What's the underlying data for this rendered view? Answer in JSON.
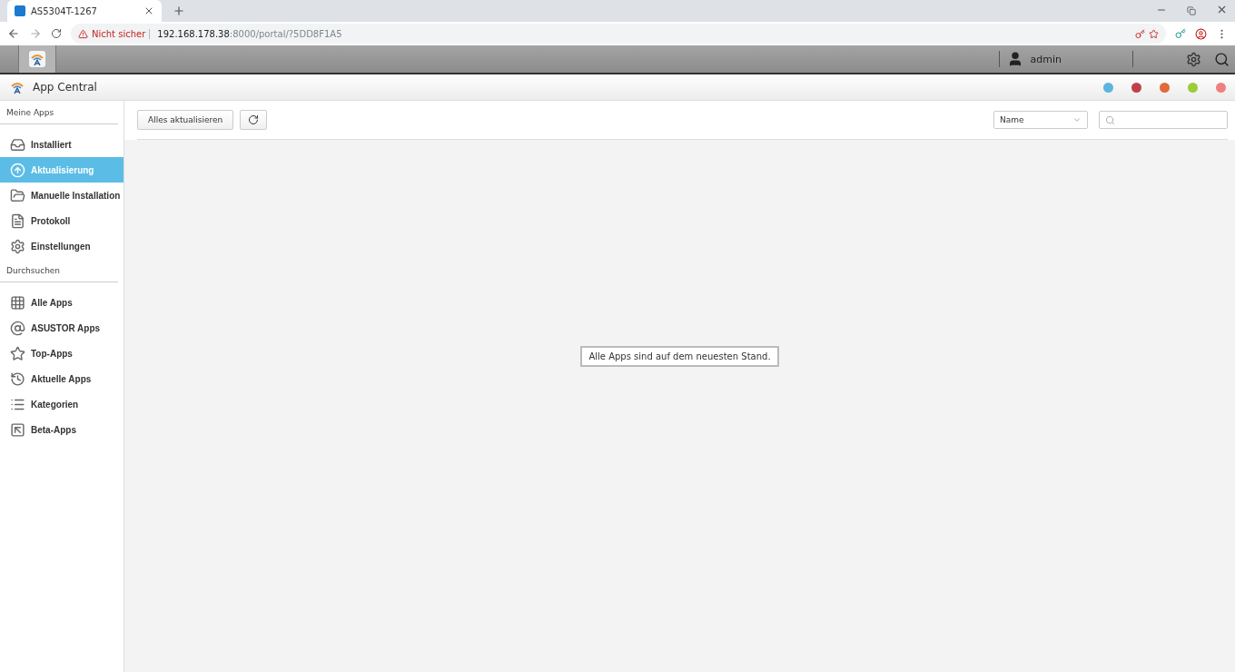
{
  "browser": {
    "tab_title": "AS5304T-1267",
    "security": "Nicht sicher",
    "url_host": "192.168.178.38",
    "url_rest": ":8000/portal/?5DD8F1A5"
  },
  "top_bar": {
    "user": "admin"
  },
  "app": {
    "title": "App Central",
    "window_dots": [
      {
        "color": "#5bb5e0"
      },
      {
        "color": "#c0404a"
      },
      {
        "color": "#e06a3a"
      },
      {
        "color": "#9ccc3a"
      },
      {
        "color": "#f08080"
      }
    ]
  },
  "sidebar": {
    "groups": [
      {
        "title": "Meine Apps",
        "items": [
          {
            "label": "Installiert",
            "selected": false
          },
          {
            "label": "Aktualisierung",
            "selected": true
          },
          {
            "label": "Manuelle Installation",
            "selected": false
          },
          {
            "label": "Protokoll",
            "selected": false
          },
          {
            "label": "Einstellungen",
            "selected": false
          }
        ]
      },
      {
        "title": "Durchsuchen",
        "items": [
          {
            "label": "Alle Apps",
            "selected": false
          },
          {
            "label": "ASUSTOR Apps",
            "selected": false
          },
          {
            "label": "Top-Apps",
            "selected": false
          },
          {
            "label": "Aktuelle Apps",
            "selected": false
          },
          {
            "label": "Kategorien",
            "selected": false
          },
          {
            "label": "Beta-Apps",
            "selected": false
          }
        ]
      }
    ]
  },
  "toolbar": {
    "update_all": "Alles aktualisieren",
    "sort": "Name"
  },
  "message": "Alle Apps sind auf dem neuesten Stand."
}
